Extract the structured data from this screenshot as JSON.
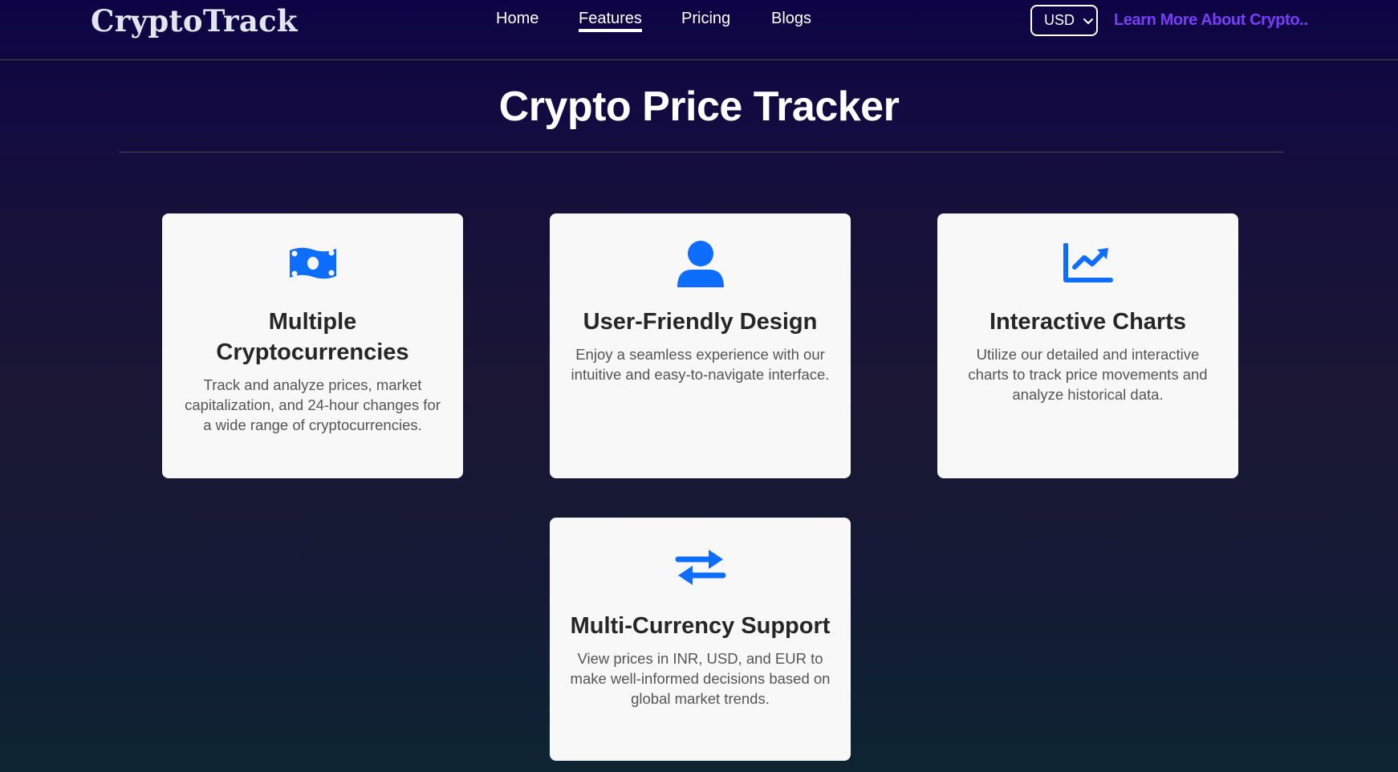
{
  "brand": "CryptoTrack",
  "nav": {
    "links": [
      "Home",
      "Features",
      "Pricing",
      "Blogs"
    ],
    "active": "Features"
  },
  "currency": {
    "selected": "USD"
  },
  "learn_more": "Learn More About Crypto..",
  "page_title": "Crypto Price Tracker",
  "features": [
    {
      "icon": "money-bill-icon",
      "title": "Multiple Cryptocurrencies",
      "description": "Track and analyze prices, market capitalization, and 24-hour changes for a wide range of cryptocurrencies."
    },
    {
      "icon": "user-icon",
      "title": "User-Friendly Design",
      "description": "Enjoy a seamless experience with our intuitive and easy-to-navigate interface."
    },
    {
      "icon": "chart-line-icon",
      "title": "Interactive Charts",
      "description": "Utilize our detailed and interactive charts to track price movements and analyze historical data."
    },
    {
      "icon": "exchange-arrows-icon",
      "title": "Multi-Currency Support",
      "description": "View prices in INR, USD, and EUR to make well-informed decisions based on global market trends."
    }
  ],
  "colors": {
    "accent_blue": "#0d6efd",
    "learn_link": "#7a3dfa",
    "background_top": "#0e0445",
    "background_bottom": "#0d2532",
    "card_bg": "#f8f8f8"
  }
}
